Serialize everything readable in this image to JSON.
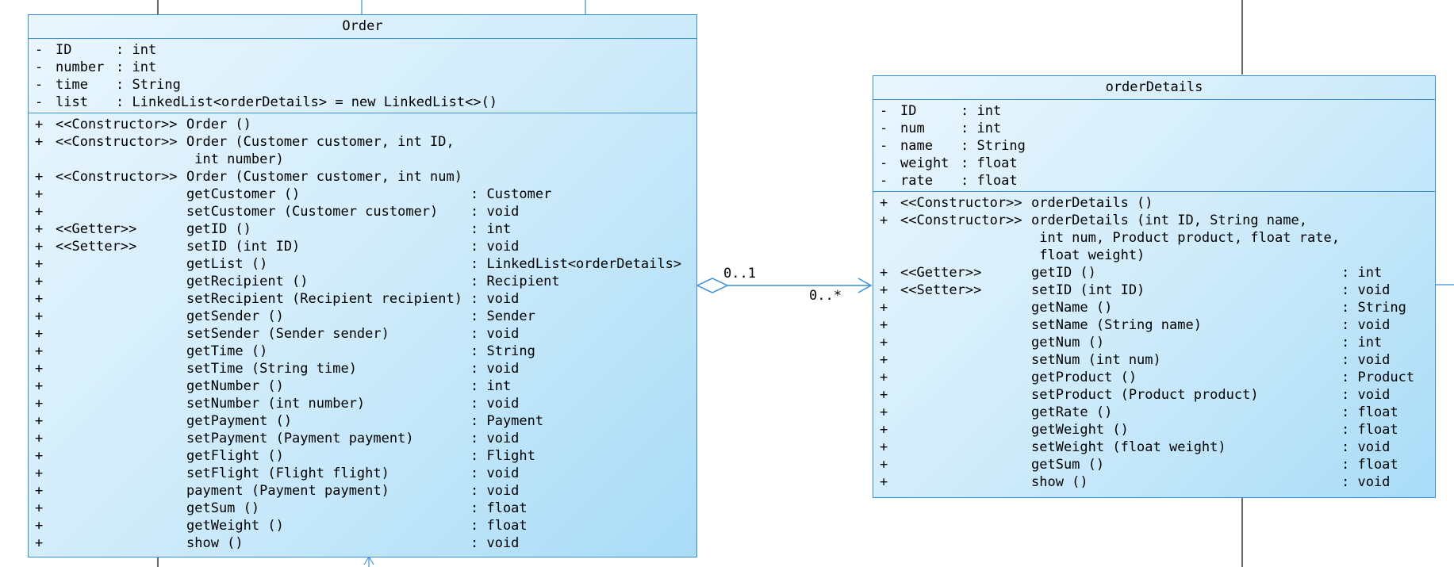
{
  "order": {
    "title": "Order",
    "attributes": [
      {
        "vis": "-",
        "name": "ID",
        "type": ": int"
      },
      {
        "vis": "-",
        "name": "number",
        "type": ": int"
      },
      {
        "vis": "-",
        "name": "time",
        "type": ": String"
      },
      {
        "vis": "-",
        "name": "list",
        "type": ": LinkedList<orderDetails> = new LinkedList<>()"
      }
    ],
    "operations": [
      {
        "vis": "+",
        "stereo": "<<Constructor>>",
        "sig": "Order ()",
        "ret": ""
      },
      {
        "vis": "+",
        "stereo": "<<Constructor>>",
        "sig": "Order (Customer customer, int ID,",
        "ret": ""
      },
      {
        "vis": "",
        "stereo": "",
        "sig": " int number)",
        "ret": ""
      },
      {
        "vis": "+",
        "stereo": "<<Constructor>>",
        "sig": "Order (Customer customer, int num)",
        "ret": ""
      },
      {
        "vis": "+",
        "stereo": "",
        "sig": "getCustomer ()",
        "ret": ": Customer"
      },
      {
        "vis": "+",
        "stereo": "",
        "sig": "setCustomer (Customer customer)",
        "ret": ": void"
      },
      {
        "vis": "+",
        "stereo": "<<Getter>>",
        "sig": "getID ()",
        "ret": ": int"
      },
      {
        "vis": "+",
        "stereo": "<<Setter>>",
        "sig": "setID (int ID)",
        "ret": ": void"
      },
      {
        "vis": "+",
        "stereo": "",
        "sig": "getList ()",
        "ret": ": LinkedList<orderDetails>"
      },
      {
        "vis": "+",
        "stereo": "",
        "sig": "getRecipient ()",
        "ret": ": Recipient"
      },
      {
        "vis": "+",
        "stereo": "",
        "sig": "setRecipient (Recipient recipient)",
        "ret": ": void"
      },
      {
        "vis": "+",
        "stereo": "",
        "sig": "getSender ()",
        "ret": ": Sender"
      },
      {
        "vis": "+",
        "stereo": "",
        "sig": "setSender (Sender sender)",
        "ret": ": void"
      },
      {
        "vis": "+",
        "stereo": "",
        "sig": "getTime ()",
        "ret": ": String"
      },
      {
        "vis": "+",
        "stereo": "",
        "sig": "setTime (String time)",
        "ret": ": void"
      },
      {
        "vis": "+",
        "stereo": "",
        "sig": "getNumber ()",
        "ret": ": int"
      },
      {
        "vis": "+",
        "stereo": "",
        "sig": "setNumber (int number)",
        "ret": ": void"
      },
      {
        "vis": "+",
        "stereo": "",
        "sig": "getPayment ()",
        "ret": ": Payment"
      },
      {
        "vis": "+",
        "stereo": "",
        "sig": "setPayment (Payment payment)",
        "ret": ": void"
      },
      {
        "vis": "+",
        "stereo": "",
        "sig": "getFlight ()",
        "ret": ": Flight"
      },
      {
        "vis": "+",
        "stereo": "",
        "sig": "setFlight (Flight flight)",
        "ret": ": void"
      },
      {
        "vis": "+",
        "stereo": "",
        "sig": "payment (Payment payment)",
        "ret": ": void"
      },
      {
        "vis": "+",
        "stereo": "",
        "sig": "getSum ()",
        "ret": ": float"
      },
      {
        "vis": "+",
        "stereo": "",
        "sig": "getWeight ()",
        "ret": ": float"
      },
      {
        "vis": "+",
        "stereo": "",
        "sig": "show ()",
        "ret": ": void"
      }
    ]
  },
  "orderDetails": {
    "title": "orderDetails",
    "attributes": [
      {
        "vis": "-",
        "name": "ID",
        "type": ": int"
      },
      {
        "vis": "-",
        "name": "num",
        "type": ": int"
      },
      {
        "vis": "-",
        "name": "name",
        "type": ": String"
      },
      {
        "vis": "-",
        "name": "weight",
        "type": ": float"
      },
      {
        "vis": "-",
        "name": "rate",
        "type": ": float"
      }
    ],
    "operations": [
      {
        "vis": "+",
        "stereo": "<<Constructor>>",
        "sig": "orderDetails ()",
        "ret": ""
      },
      {
        "vis": "+",
        "stereo": "<<Constructor>>",
        "sig": "orderDetails (int ID, String name,",
        "ret": ""
      },
      {
        "vis": "",
        "stereo": "",
        "sig": " int num, Product product, float rate,",
        "ret": ""
      },
      {
        "vis": "",
        "stereo": "",
        "sig": " float weight)",
        "ret": ""
      },
      {
        "vis": "+",
        "stereo": "<<Getter>>",
        "sig": "getID ()",
        "ret": ": int"
      },
      {
        "vis": "+",
        "stereo": "<<Setter>>",
        "sig": "setID (int ID)",
        "ret": ": void"
      },
      {
        "vis": "+",
        "stereo": "",
        "sig": "getName ()",
        "ret": ": String"
      },
      {
        "vis": "+",
        "stereo": "",
        "sig": "setName (String name)",
        "ret": ": void"
      },
      {
        "vis": "+",
        "stereo": "",
        "sig": "getNum ()",
        "ret": ": int"
      },
      {
        "vis": "+",
        "stereo": "",
        "sig": "setNum (int num)",
        "ret": ": void"
      },
      {
        "vis": "+",
        "stereo": "",
        "sig": "getProduct ()",
        "ret": ": Product"
      },
      {
        "vis": "+",
        "stereo": "",
        "sig": "setProduct (Product product)",
        "ret": ": void"
      },
      {
        "vis": "+",
        "stereo": "",
        "sig": "getRate ()",
        "ret": ": float"
      },
      {
        "vis": "+",
        "stereo": "",
        "sig": "getWeight ()",
        "ret": ": float"
      },
      {
        "vis": "+",
        "stereo": "",
        "sig": "setWeight (float weight)",
        "ret": ": void"
      },
      {
        "vis": "+",
        "stereo": "",
        "sig": "getSum ()",
        "ret": ": float"
      },
      {
        "vis": "+",
        "stereo": "",
        "sig": "show ()",
        "ret": ": void"
      }
    ]
  },
  "association": {
    "source_multiplicity": "0..1",
    "target_multiplicity": "0..*"
  },
  "colors": {
    "border": "#3b8fd6",
    "line": "#3b8fd6",
    "fill_light": "#eaf6fe",
    "fill_dark": "#a9dcf7"
  }
}
